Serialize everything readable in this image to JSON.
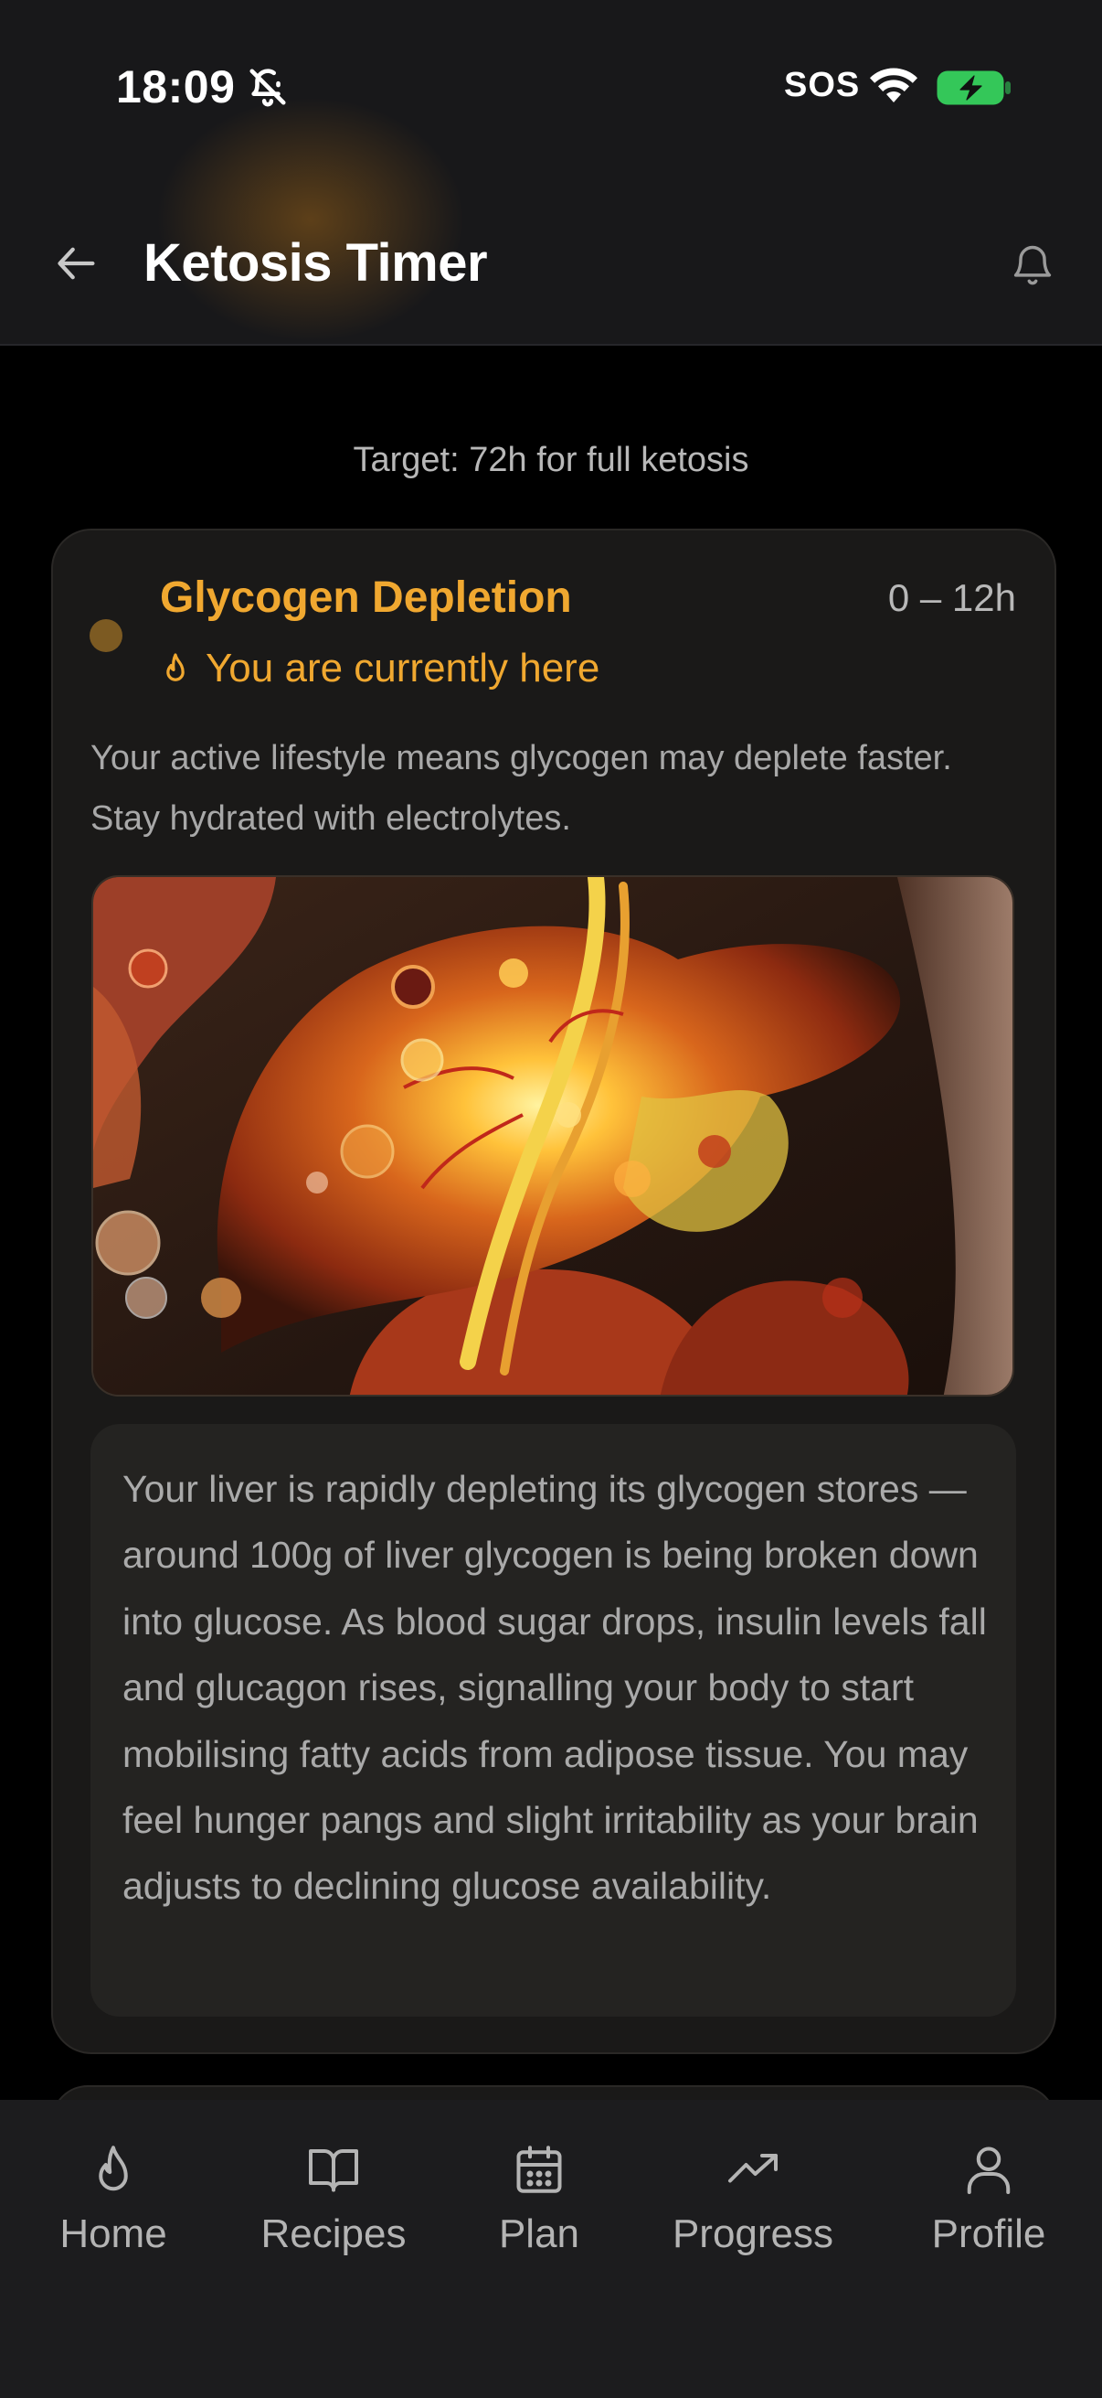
{
  "status_bar": {
    "time": "18:09",
    "sos": "SOS"
  },
  "header": {
    "title": "Ketosis Timer"
  },
  "target": "Target: 72h for full ketosis",
  "phase": {
    "name": "Glycogen Depletion",
    "range": "0 – 12h",
    "current_label": "You are currently here",
    "description": "Your active lifestyle means glycogen may deplete faster. Stay hydrated with electrolytes.",
    "detail": "Your liver is rapidly depleting its glycogen stores — around 100g of liver glycogen is being broken down into glucose. As blood sugar drops, insulin levels fall and glucagon rises, signalling your body to start mobilising fatty acids from adipose tissue. You may feel hunger pangs and slight irritability as your brain adjusts to declining glucose availability.",
    "accent_color": "#f0a830"
  },
  "tabs": [
    {
      "label": "Home",
      "icon": "flame-icon"
    },
    {
      "label": "Recipes",
      "icon": "book-icon"
    },
    {
      "label": "Plan",
      "icon": "calendar-icon"
    },
    {
      "label": "Progress",
      "icon": "trending-up-icon"
    },
    {
      "label": "Profile",
      "icon": "user-icon"
    }
  ]
}
